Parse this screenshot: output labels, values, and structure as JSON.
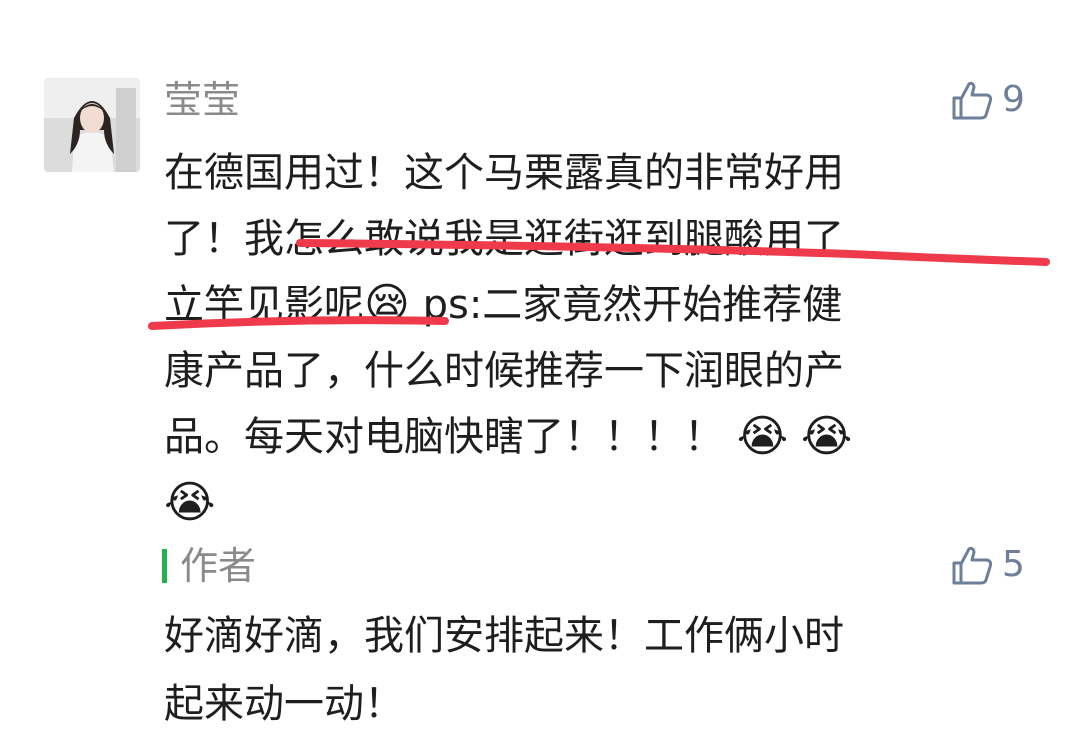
{
  "comment": {
    "username": "莹莹",
    "like_count": "9",
    "lines": [
      "在德国用过！这个马栗露真的非常好用",
      "了！我怎么敢说我是逛街逛到腿酸用了",
      "立竿见影呢",
      "康产品了，什么时候推荐一下润眼的产",
      "品。每天对电脑快瞎了！！！！"
    ],
    "line3_rest": " ps:二家竟然开始推荐健",
    "emojis": {
      "sleepy": "😪",
      "crying": "😭"
    }
  },
  "reply": {
    "author_label": "作者",
    "like_count": "5",
    "lines": [
      "好滴好滴，我们安排起来！工作俩小时",
      "起来动一动！"
    ]
  },
  "colors": {
    "text": "#1e1e1e",
    "meta": "#8a8a8a",
    "like": "#6e7f99",
    "underline": "#ee3a4a",
    "reply_bar": "#21b24b"
  }
}
